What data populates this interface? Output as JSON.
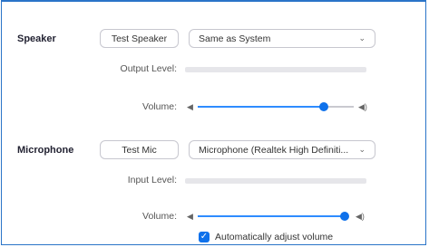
{
  "speaker": {
    "section_label": "Speaker",
    "test_button": "Test Speaker",
    "device_select": "Same as System",
    "output_level_label": "Output Level:",
    "volume_label": "Volume:",
    "volume_level": 0.81
  },
  "microphone": {
    "section_label": "Microphone",
    "test_button": "Test Mic",
    "device_select": "Microphone (Realtek High Definiti...",
    "input_level_label": "Input Level:",
    "volume_label": "Volume:",
    "volume_level": 1.0,
    "auto_adjust_label": "Automatically adjust volume",
    "auto_adjust_checked": true
  },
  "colors": {
    "accent": "#0e71eb",
    "frame_border": "#2a74c8"
  }
}
